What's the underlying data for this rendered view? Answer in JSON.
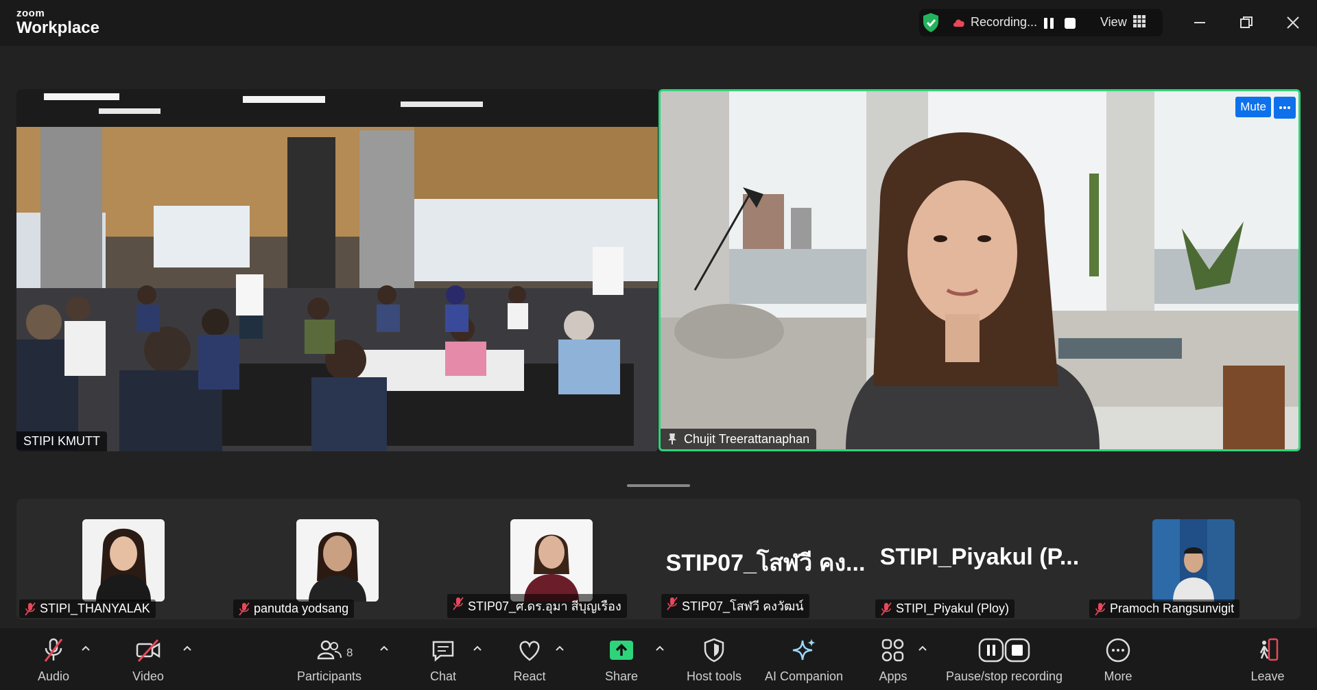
{
  "app": {
    "logo_small": "zoom",
    "logo_big": "Workplace"
  },
  "recording": {
    "status": "Recording..."
  },
  "view": {
    "label": "View"
  },
  "tiles": {
    "room": {
      "name": "STIPI KMUTT"
    },
    "speaker": {
      "name": "Chujit Treerattanaphan",
      "mute_label": "Mute"
    }
  },
  "participants_strip": [
    {
      "name": "STIPI_THANYALAK",
      "has_video": true
    },
    {
      "name": "panutda yodsang",
      "has_video": true
    },
    {
      "name": "STIP07_ศ.ดร.อุมา สีบุญเรือง",
      "has_video": true
    },
    {
      "name": "STIP07_โสฬวี คงวัฒน์",
      "display": "STIP07_โสฬวี คง...",
      "has_video": false
    },
    {
      "name": "STIPI_Piyakul (Ploy)",
      "display": "STIPI_Piyakul  (P...",
      "has_video": false
    },
    {
      "name": "Pramoch Rangsunvigit",
      "has_video": true
    }
  ],
  "toolbar": {
    "audio": "Audio",
    "video": "Video",
    "participants": "Participants",
    "participants_count": "8",
    "chat": "Chat",
    "react": "React",
    "share": "Share",
    "host_tools": "Host tools",
    "ai_companion": "AI Companion",
    "apps": "Apps",
    "pause_stop": "Pause/stop recording",
    "more": "More",
    "leave": "Leave"
  },
  "colors": {
    "active_speaker": "#2ed47a",
    "share": "#2ed47a",
    "accent_blue": "#0e71eb",
    "muted_red": "#e8485a"
  }
}
